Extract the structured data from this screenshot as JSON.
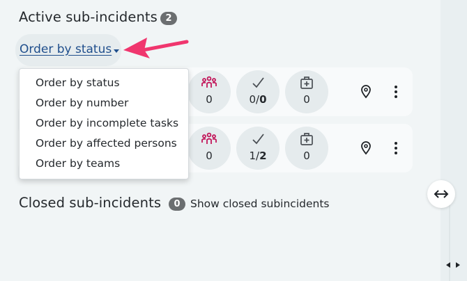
{
  "active": {
    "title": "Active sub-incidents",
    "count": "2"
  },
  "order": {
    "label": "Order by status",
    "options": [
      "Order by status",
      "Order by number",
      "Order by incomplete tasks",
      "Order by affected persons",
      "Order by teams"
    ]
  },
  "cards": [
    {
      "persons": "0",
      "tasks_done": "0",
      "tasks_total": "0",
      "resources": "0"
    },
    {
      "persons": "0",
      "tasks_done": "1",
      "tasks_total": "2",
      "resources": "0"
    }
  ],
  "closed": {
    "title": "Closed sub-incidents",
    "count": "0",
    "show_link": "Show closed subincidents"
  },
  "icons": {
    "persons": "group-icon",
    "tasks": "checkmark-icon",
    "resources": "first-aid-kit-icon",
    "location": "map-pin-icon",
    "menu": "more-vertical-icon",
    "resize": "horizontal-resize-icon",
    "annotation": "arrow-icon"
  },
  "colors": {
    "link": "#1f4e8c",
    "persons_icon": "#c2185b",
    "annotation_arrow": "#f0366e",
    "badge": "#6b6e70"
  }
}
